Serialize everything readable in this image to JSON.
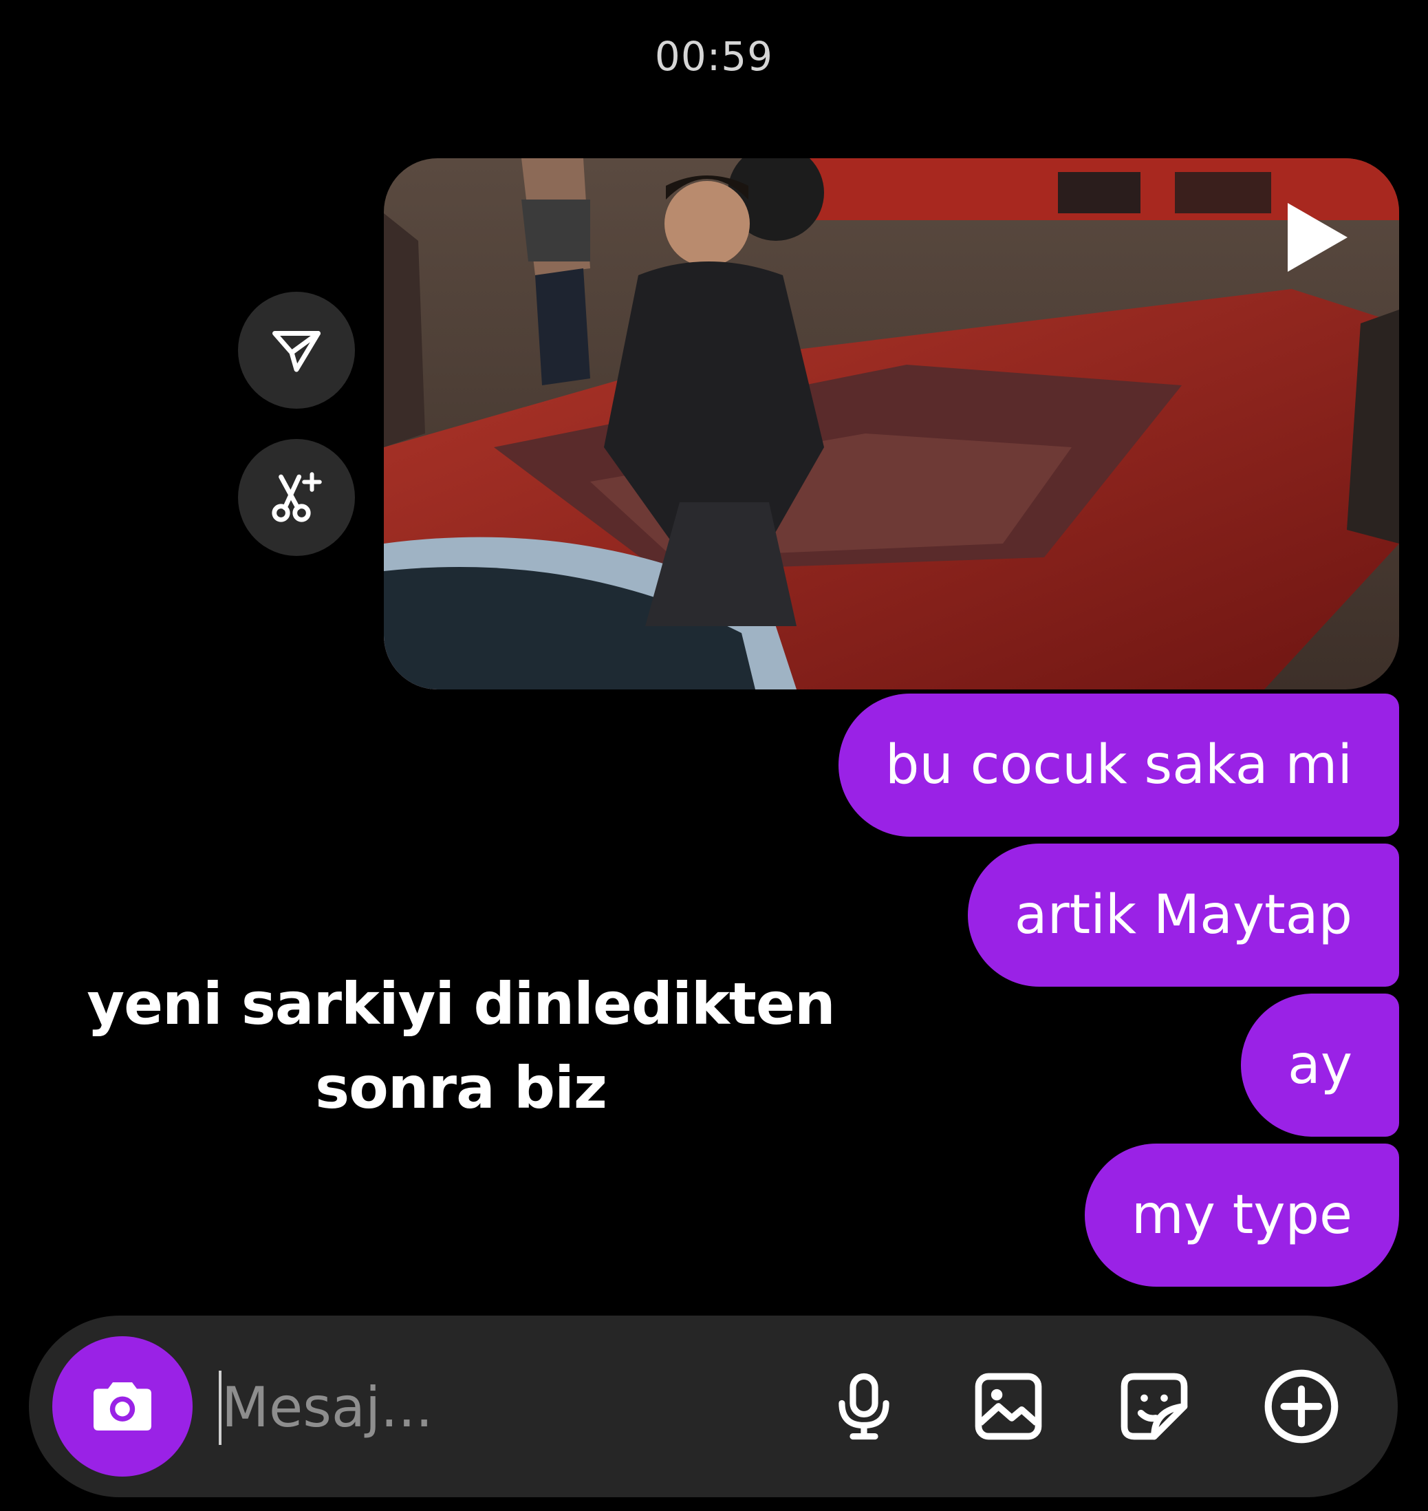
{
  "status": {
    "time": "00:59"
  },
  "media_card": {
    "play_icon": "play-icon"
  },
  "side_actions": [
    {
      "name": "share",
      "icon": "paper-plane-icon"
    },
    {
      "name": "ai-edit",
      "icon": "scissors-sparkle-icon"
    }
  ],
  "messages": [
    {
      "text": "bu cocuk saka mi"
    },
    {
      "text": "artik Maytap"
    },
    {
      "text": "ay"
    },
    {
      "text": "my type"
    }
  ],
  "caption": {
    "line1": "yeni sarkiyi dinledikten",
    "line2": "sonra biz"
  },
  "composer": {
    "placeholder": "Mesaj...",
    "icons": [
      "camera-icon",
      "microphone-icon",
      "gallery-icon",
      "sticker-icon",
      "plus-icon"
    ]
  },
  "colors": {
    "bubble": "#9a22e6",
    "background": "#000000",
    "composer": "#262626"
  }
}
